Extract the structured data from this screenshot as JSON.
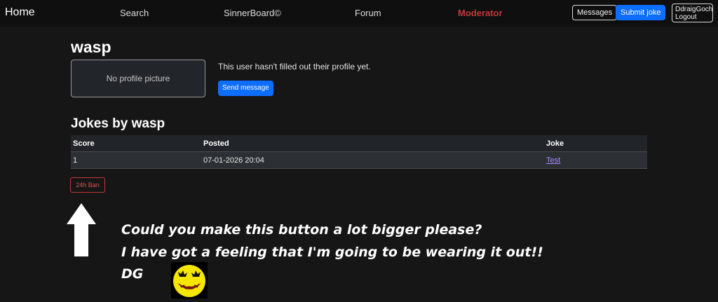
{
  "nav": {
    "brand": "Home",
    "links": [
      "Search",
      "SinnerBoard©",
      "Forum",
      "Moderator"
    ],
    "messages": "Messages",
    "submit_joke": "Submit joke",
    "user": "DdraigGoch",
    "logout": "Logout"
  },
  "profile": {
    "username": "wasp",
    "no_picture": "No profile picture",
    "empty_text": "This user hasn't filled out their profile yet.",
    "send_message": "Send message"
  },
  "jokes": {
    "title": "Jokes by wasp",
    "headers": [
      "Score",
      "Posted",
      "Joke"
    ],
    "rows": [
      {
        "score": "1",
        "posted": "07-01-2026 20:04",
        "joke": "Test"
      }
    ]
  },
  "ban_button": "24h Ban",
  "annotation": {
    "line1": "Could you make this button a lot bigger please?",
    "line2": "I have got a feeling that I'm going to be wearing it out!!",
    "line3": "DG"
  },
  "colors": {
    "accent": "#0d6efd",
    "moderator": "#c0393b",
    "link": "#a78bfa",
    "smiley": "#f5e600"
  }
}
